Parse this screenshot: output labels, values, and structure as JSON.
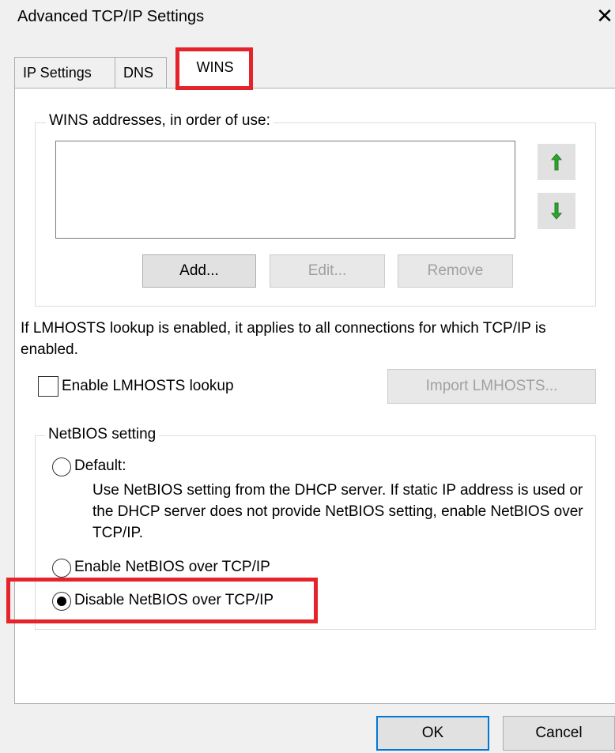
{
  "window": {
    "title": "Advanced TCP/IP Settings",
    "close_glyph": "✕"
  },
  "tabs": [
    {
      "label": "IP Settings",
      "active": false
    },
    {
      "label": "DNS",
      "active": false
    },
    {
      "label": "WINS",
      "active": true
    }
  ],
  "wins": {
    "group_label": "WINS addresses, in order of use:",
    "addresses": [],
    "add_label": "Add...",
    "edit_label": "Edit...",
    "remove_label": "Remove",
    "up_arrow_icon": "arrow-up-icon",
    "down_arrow_icon": "arrow-down-icon",
    "arrow_color": "#2fa52f"
  },
  "lmhosts": {
    "info_text": "If LMHOSTS lookup is enabled, it applies to all connections for which TCP/IP is enabled.",
    "checkbox_label": "Enable LMHOSTS lookup",
    "checked": false,
    "import_label": "Import LMHOSTS..."
  },
  "netbios": {
    "group_label": "NetBIOS setting",
    "options": [
      {
        "label": "Default:",
        "selected": false
      },
      {
        "label": "Enable NetBIOS over TCP/IP",
        "selected": false
      },
      {
        "label": "Disable NetBIOS over TCP/IP",
        "selected": true
      }
    ],
    "default_description": "Use NetBIOS setting from the DHCP server. If static IP address is used or the DHCP server does not provide NetBIOS setting, enable NetBIOS over TCP/IP."
  },
  "footer": {
    "ok_label": "OK",
    "cancel_label": "Cancel"
  },
  "colors": {
    "highlight": "#e4232a",
    "default_button_border": "#0078d7",
    "dialog_bg": "#f0f0f0"
  }
}
